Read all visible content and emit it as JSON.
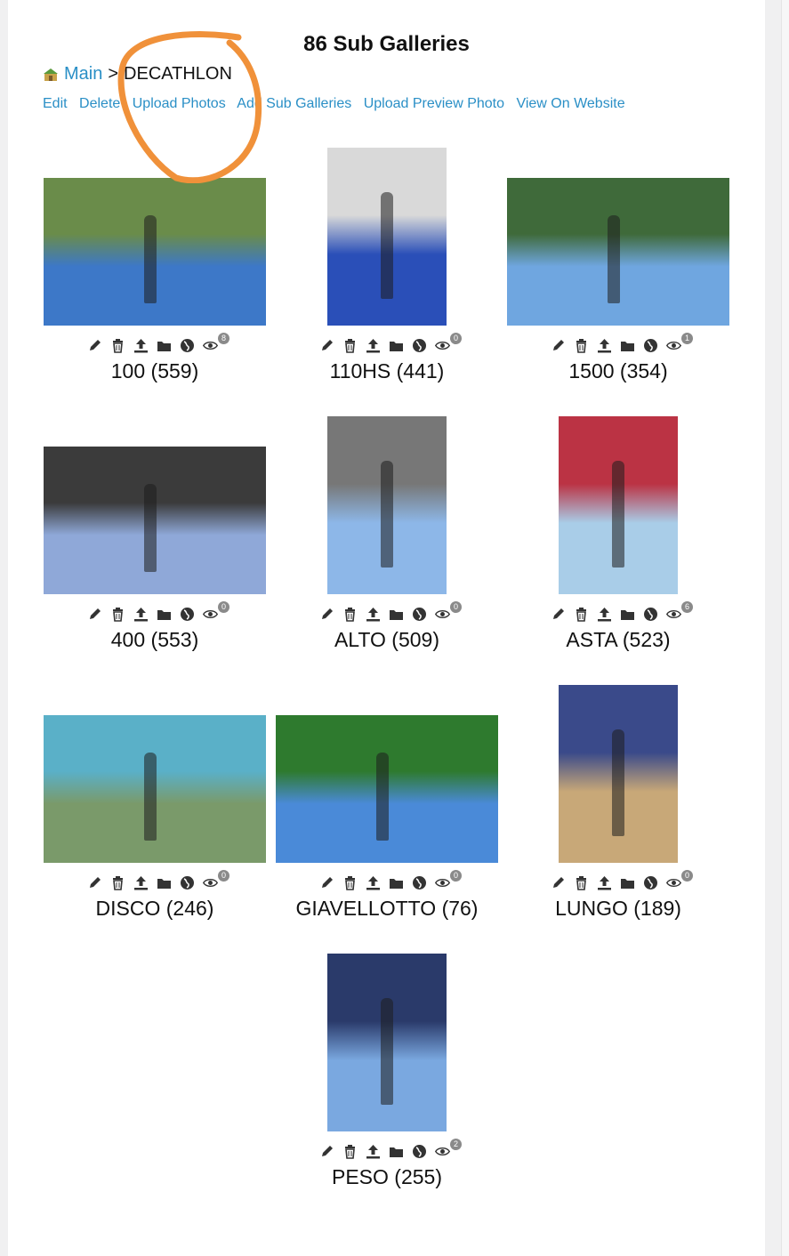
{
  "page_title": "86 Sub Galleries",
  "breadcrumb": {
    "home_label": "Main",
    "separator": ">",
    "current": "DECATHLON"
  },
  "actions": [
    "Edit",
    "Delete",
    "Upload Photos",
    "Add Sub Galleries",
    "Upload Preview Photo",
    "View On Website"
  ],
  "colors": {
    "link": "#2a8fc6",
    "annotation": "#f0913a",
    "badge": "#8a8a8a"
  },
  "icons": [
    "pencil-icon",
    "trash-icon",
    "upload-icon",
    "folder-icon",
    "globe-icon",
    "eye-icon"
  ],
  "galleries": [
    {
      "label": "100 (559)",
      "views": "8"
    },
    {
      "label": "110HS (441)",
      "views": "0"
    },
    {
      "label": "1500 (354)",
      "views": "1"
    },
    {
      "label": "400 (553)",
      "views": "0"
    },
    {
      "label": "ALTO (509)",
      "views": "0"
    },
    {
      "label": "ASTA (523)",
      "views": "6"
    },
    {
      "label": "DISCO (246)",
      "views": "0"
    },
    {
      "label": "GIAVELLOTTO (76)",
      "views": "0"
    },
    {
      "label": "LUNGO (189)",
      "views": "0"
    },
    {
      "label": "PESO (255)",
      "views": "2"
    }
  ]
}
